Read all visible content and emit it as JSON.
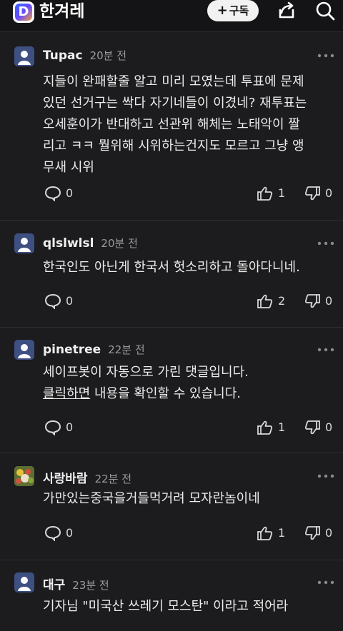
{
  "header": {
    "logo_letter": "D",
    "brand": "한겨레",
    "subscribe_plus": "+",
    "subscribe_label": "구독",
    "icons": [
      "share-icon",
      "search-icon"
    ]
  },
  "comments": [
    {
      "user": "Tupac",
      "time": "20분 전",
      "lines": [
        "지들이 완패할줄 알고 미리 모였는데 투표에 문제",
        "있던 선거구는 싹다 자기네들이 이겼네? 재투표는",
        "오세훈이가 반대하고 선관위 해체는 노태악이 짤",
        "리고 ㅋㅋ 뭘위해 시위하는건지도 모르고 그냥 앵",
        "무새 시위"
      ],
      "replies": "0",
      "likes": "1",
      "dislikes": "0"
    },
    {
      "user": "qlslwlsl",
      "time": "20분 전",
      "lines": [
        "한국인도 아닌게 한국서 헛소리하고 돌아다니네."
      ],
      "replies": "0",
      "likes": "2",
      "dislikes": "0"
    },
    {
      "user": "pinetree",
      "time": "22분 전",
      "lines": [
        "세이프봇이 자동으로 가린 댓글입니다."
      ],
      "link_text": "클릭하면",
      "link_rest": " 내용을 확인할 수 있습니다.",
      "replies": "0",
      "likes": "1",
      "dislikes": "0"
    },
    {
      "user": "사랑바람",
      "time": "22분 전",
      "lines": [
        "가만있는중국을거들먹거려 모자란놈이네"
      ],
      "replies": "0",
      "likes": "1",
      "dislikes": "0"
    },
    {
      "user": "대구",
      "time": "23분 전",
      "lines": [
        "기자님 \"미국산 쓰레기 모스탄\" 이라고 적어라"
      ]
    }
  ]
}
